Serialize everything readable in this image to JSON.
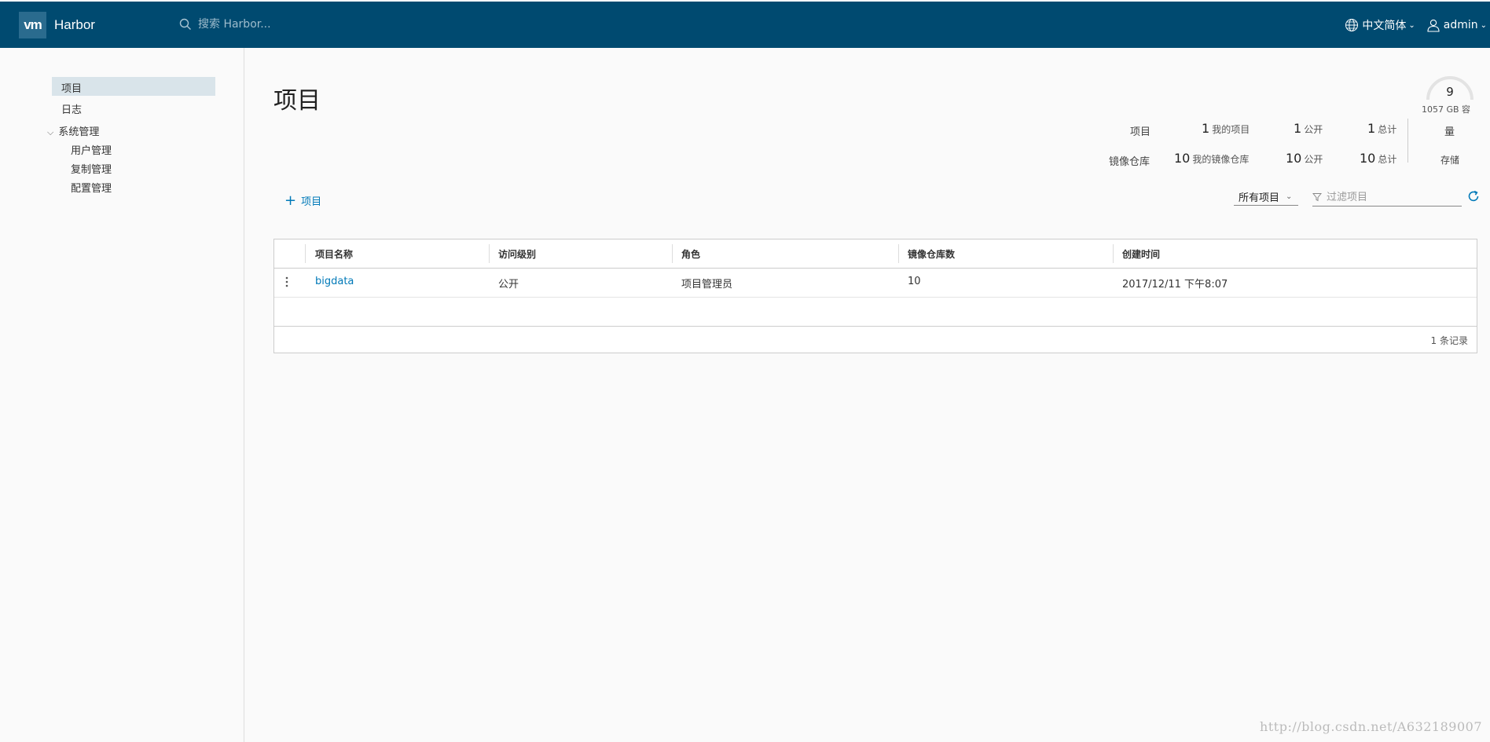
{
  "header": {
    "logo_text": "vm",
    "brand": "Harbor",
    "search_placeholder": "搜索 Harbor...",
    "language": "中文简体",
    "user": "admin",
    "bg_color": "#004a70"
  },
  "sidebar": {
    "items": [
      {
        "label": "项目",
        "active": true
      },
      {
        "label": "日志"
      },
      {
        "label": "系统管理",
        "expanded": true,
        "children": [
          {
            "label": "用户管理"
          },
          {
            "label": "复制管理"
          },
          {
            "label": "配置管理"
          }
        ]
      }
    ]
  },
  "main": {
    "title": "项目",
    "add_button": "项目",
    "filter_select": "所有项目",
    "filter_placeholder": "过滤项目"
  },
  "summary": {
    "projects": {
      "label": "项目",
      "mine": "1",
      "mine_label": "我的项目",
      "public": "1",
      "public_label": "公开",
      "total": "1",
      "total_label": "总计"
    },
    "repos": {
      "label": "镜像仓库",
      "mine": "10",
      "mine_label": "我的镜像仓库",
      "public": "10",
      "public_label": "公开",
      "total": "10",
      "total_label": "总计"
    },
    "storage": {
      "value": "9",
      "capacity": "1057 GB 容",
      "capacity_cont": "量",
      "label": "存储"
    }
  },
  "table": {
    "columns": [
      "项目名称",
      "访问级别",
      "角色",
      "镜像仓库数",
      "创建时间"
    ],
    "rows": [
      {
        "name": "bigdata",
        "access": "公开",
        "role": "项目管理员",
        "repo_count": "10",
        "created": "2017/12/11 下午8:07"
      }
    ],
    "footer": "1 条记录"
  },
  "watermark": "http://blog.csdn.net/A632189007"
}
